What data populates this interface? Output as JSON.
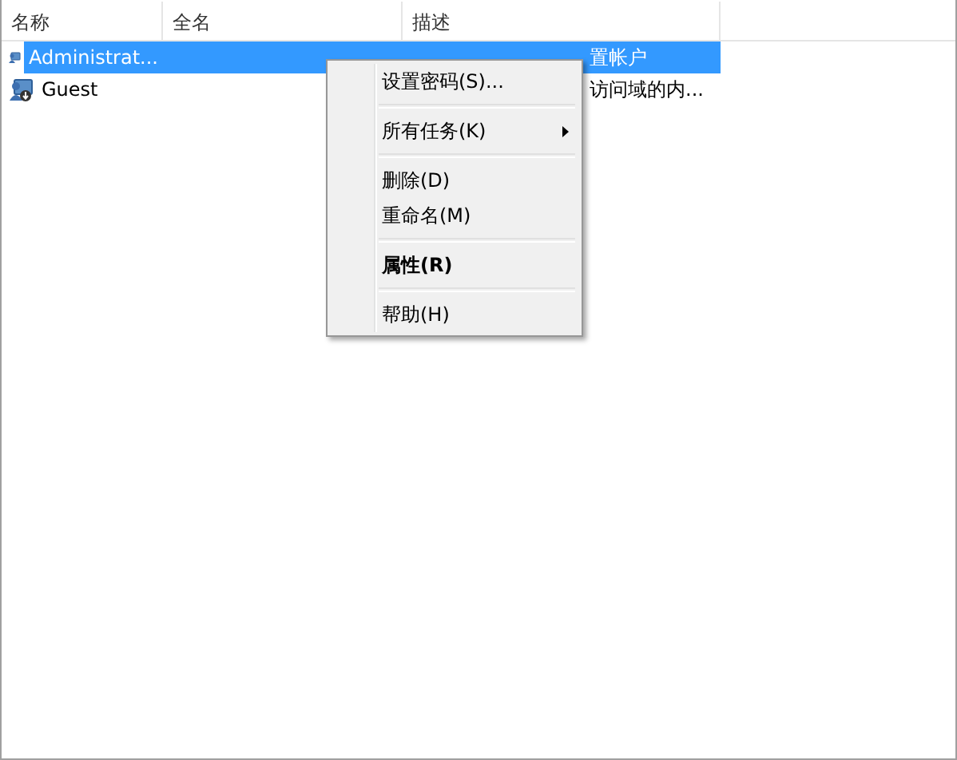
{
  "table": {
    "columns": [
      "名称",
      "全名",
      "描述"
    ],
    "rows": [
      {
        "name": "Administrat...",
        "description": "置帐户",
        "selected": true
      },
      {
        "name": "Guest",
        "description": "访问域的内...",
        "selected": false
      }
    ]
  },
  "context_menu": {
    "items": [
      {
        "kind": "item",
        "label": "设置密码(S)...",
        "bold": false,
        "submenu": false
      },
      {
        "kind": "separator"
      },
      {
        "kind": "item",
        "label": "所有任务(K)",
        "bold": false,
        "submenu": true
      },
      {
        "kind": "separator"
      },
      {
        "kind": "item",
        "label": "删除(D)",
        "bold": false,
        "submenu": false
      },
      {
        "kind": "item",
        "label": "重命名(M)",
        "bold": false,
        "submenu": false
      },
      {
        "kind": "separator"
      },
      {
        "kind": "item",
        "label": "属性(R)",
        "bold": true,
        "submenu": false
      },
      {
        "kind": "separator"
      },
      {
        "kind": "item",
        "label": "帮助(H)",
        "bold": false,
        "submenu": false
      }
    ]
  }
}
